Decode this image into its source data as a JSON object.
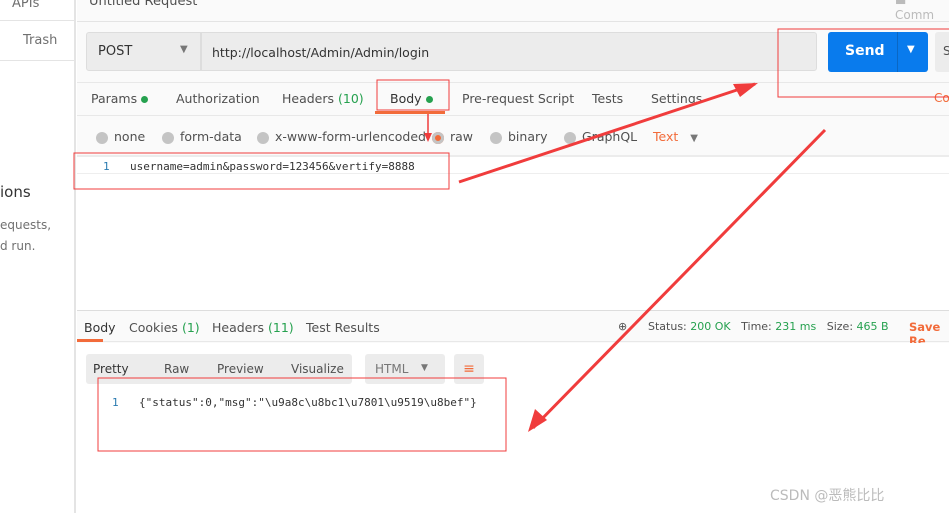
{
  "sidebar": {
    "apis_label": "APIs",
    "trash_label": "Trash",
    "heading_fragment": "ions",
    "text_line1": "equests,",
    "text_line2": "d run."
  },
  "request": {
    "title": "Untitled Request",
    "comments_label": "Comm",
    "method": "POST",
    "url": "http://localhost/Admin/Admin/login",
    "send_label": "Send",
    "save_fragment": "S",
    "cookies_fragment": "Co",
    "tabs": [
      {
        "label": "Params",
        "dot": true
      },
      {
        "label": "Authorization"
      },
      {
        "label": "Headers",
        "count": "(10)"
      },
      {
        "label": "Body",
        "dot": true,
        "active": true
      },
      {
        "label": "Pre-request Script"
      },
      {
        "label": "Tests"
      },
      {
        "label": "Settings"
      }
    ],
    "body_types": [
      "none",
      "form-data",
      "x-www-form-urlencoded",
      "raw",
      "binary",
      "GraphQL"
    ],
    "selected_body_type": "raw",
    "raw_format": "Text",
    "body_line_number": "1",
    "body_content": "username=admin&password=123456&vertify=8888"
  },
  "response": {
    "tabs": [
      {
        "label": "Body",
        "active": true
      },
      {
        "label": "Cookies",
        "count": "(1)"
      },
      {
        "label": "Headers",
        "count": "(11)"
      },
      {
        "label": "Test Results"
      }
    ],
    "status_label": "Status:",
    "status_value": "200 OK",
    "time_label": "Time:",
    "time_value": "231 ms",
    "size_label": "Size:",
    "size_value": "465 B",
    "save_label": "Save Re",
    "view_modes": [
      "Pretty",
      "Raw",
      "Preview",
      "Visualize"
    ],
    "format": "HTML",
    "line_number": "1",
    "content": "{\"status\":0,\"msg\":\"\\u9a8c\\u8bc1\\u7801\\u9519\\u8bef\"}"
  },
  "watermark": "CSDN @恶熊比比",
  "colors": {
    "accent": "#f26b3a",
    "send": "#097bed",
    "green": "#26a14f",
    "annotation": "#f03c3c"
  }
}
